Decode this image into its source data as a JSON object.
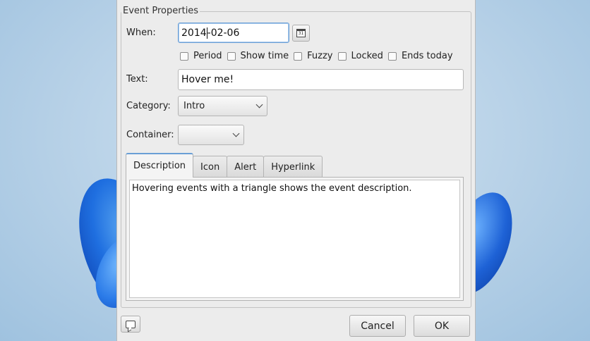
{
  "dialog": {
    "group_title": "Event Properties",
    "when": {
      "label": "When:",
      "date_before": "2014",
      "date_after": "-02-06",
      "calendar_glyph": "31"
    },
    "checkboxes": [
      {
        "label": "Period",
        "checked": false
      },
      {
        "label": "Show time",
        "checked": false
      },
      {
        "label": "Fuzzy",
        "checked": false
      },
      {
        "label": "Locked",
        "checked": false
      },
      {
        "label": "Ends today",
        "checked": false
      }
    ],
    "text": {
      "label": "Text:",
      "value": "Hover me!"
    },
    "category": {
      "label": "Category:",
      "value": "Intro"
    },
    "container": {
      "label": "Container:",
      "value": ""
    },
    "tabs": [
      "Description",
      "Icon",
      "Alert",
      "Hyperlink"
    ],
    "active_tab": "Description",
    "description": "Hovering events with a triangle shows the event description.",
    "buttons": {
      "cancel": "Cancel",
      "ok": "OK"
    },
    "icons": {
      "calendar": "calendar-icon",
      "help": "speech-bubble-icon"
    },
    "colors": {
      "focus": "#6a9fd6",
      "dialog_bg": "#ececec"
    }
  }
}
